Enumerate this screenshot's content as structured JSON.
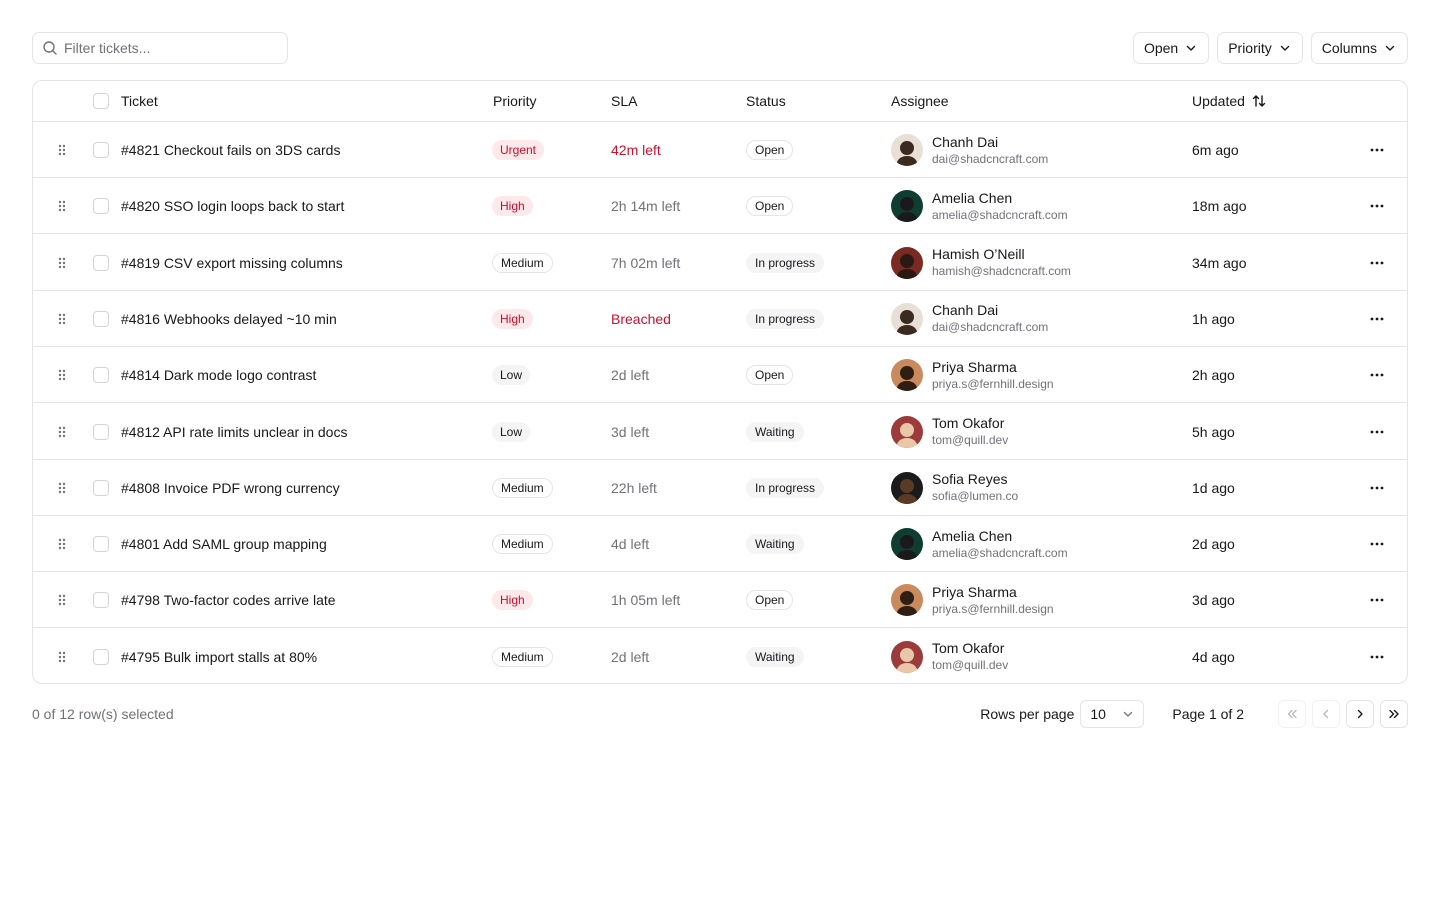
{
  "toolbar": {
    "search_placeholder": "Filter tickets...",
    "filters": [
      "Open",
      "Priority",
      "Columns"
    ]
  },
  "table": {
    "headers": {
      "ticket": "Ticket",
      "priority": "Priority",
      "sla": "SLA",
      "status": "Status",
      "assignee": "Assignee",
      "updated": "Updated"
    },
    "rows": [
      {
        "ticket": "#4821 Checkout fails on 3DS cards",
        "priority": "Urgent",
        "priority_kind": "urgent",
        "sla": "42m left",
        "sla_alert": true,
        "status": "Open",
        "status_kind": "open",
        "name": "Chanh Dai",
        "email": "dai@shadcncraft.com",
        "updated": "6m ago",
        "avatar_bg": "#e8e0d6",
        "avatar_fg": "#3b2a20"
      },
      {
        "ticket": "#4820 SSO login loops back to start",
        "priority": "High",
        "priority_kind": "high",
        "sla": "2h 14m left",
        "sla_alert": false,
        "status": "Open",
        "status_kind": "open",
        "name": "Amelia Chen",
        "email": "amelia@shadcncraft.com",
        "updated": "18m ago",
        "avatar_bg": "#0f3d32",
        "avatar_fg": "#1a1a1a"
      },
      {
        "ticket": "#4819 CSV export missing columns",
        "priority": "Medium",
        "priority_kind": "medium",
        "sla": "7h 02m left",
        "sla_alert": false,
        "status": "In progress",
        "status_kind": "inprogress",
        "name": "Hamish O’Neill",
        "email": "hamish@shadcncraft.com",
        "updated": "34m ago",
        "avatar_bg": "#7a2a22",
        "avatar_fg": "#2a1a14"
      },
      {
        "ticket": "#4816 Webhooks delayed ~10 min",
        "priority": "High",
        "priority_kind": "high",
        "sla": "Breached",
        "sla_alert": true,
        "status": "In progress",
        "status_kind": "inprogress",
        "name": "Chanh Dai",
        "email": "dai@shadcncraft.com",
        "updated": "1h ago",
        "avatar_bg": "#e8e0d6",
        "avatar_fg": "#3b2a20"
      },
      {
        "ticket": "#4814 Dark mode logo contrast",
        "priority": "Low",
        "priority_kind": "low",
        "sla": "2d left",
        "sla_alert": false,
        "status": "Open",
        "status_kind": "open",
        "name": "Priya Sharma",
        "email": "priya.s@fernhill.design",
        "updated": "2h ago",
        "avatar_bg": "#c98a5e",
        "avatar_fg": "#2e1e14"
      },
      {
        "ticket": "#4812 API rate limits unclear in docs",
        "priority": "Low",
        "priority_kind": "low",
        "sla": "3d left",
        "sla_alert": false,
        "status": "Waiting",
        "status_kind": "waiting",
        "name": "Tom Okafor",
        "email": "tom@quill.dev",
        "updated": "5h ago",
        "avatar_bg": "#9b3b3b",
        "avatar_fg": "#e8c8a8"
      },
      {
        "ticket": "#4808 Invoice PDF wrong currency",
        "priority": "Medium",
        "priority_kind": "medium",
        "sla": "22h left",
        "sla_alert": false,
        "status": "In progress",
        "status_kind": "inprogress",
        "name": "Sofia Reyes",
        "email": "sofia@lumen.co",
        "updated": "1d ago",
        "avatar_bg": "#1b1b1b",
        "avatar_fg": "#5a3a24"
      },
      {
        "ticket": "#4801 Add SAML group mapping",
        "priority": "Medium",
        "priority_kind": "medium",
        "sla": "4d left",
        "sla_alert": false,
        "status": "Waiting",
        "status_kind": "waiting",
        "name": "Amelia Chen",
        "email": "amelia@shadcncraft.com",
        "updated": "2d ago",
        "avatar_bg": "#0f3d32",
        "avatar_fg": "#1a1a1a"
      },
      {
        "ticket": "#4798 Two-factor codes arrive late",
        "priority": "High",
        "priority_kind": "high",
        "sla": "1h 05m left",
        "sla_alert": false,
        "status": "Open",
        "status_kind": "open",
        "name": "Priya Sharma",
        "email": "priya.s@fernhill.design",
        "updated": "3d ago",
        "avatar_bg": "#c98a5e",
        "avatar_fg": "#2e1e14"
      },
      {
        "ticket": "#4795 Bulk import stalls at 80%",
        "priority": "Medium",
        "priority_kind": "medium",
        "sla": "2d left",
        "sla_alert": false,
        "status": "Waiting",
        "status_kind": "waiting",
        "name": "Tom Okafor",
        "email": "tom@quill.dev",
        "updated": "4d ago",
        "avatar_bg": "#9b3b3b",
        "avatar_fg": "#e8c8a8"
      }
    ]
  },
  "footer": {
    "selected_text": "0 of 12 row(s) selected",
    "rows_per_page_label": "Rows per page",
    "rows_per_page_value": "10",
    "page_info": "Page 1 of 2"
  },
  "colors": {
    "alert": "#c8102e",
    "border": "#e4e4e7",
    "muted": "#71717a"
  },
  "icons": [
    "search-icon",
    "chevron-down-icon",
    "sort-icon",
    "grip-icon",
    "more-icon",
    "first-page-icon",
    "prev-page-icon",
    "next-page-icon",
    "last-page-icon"
  ]
}
